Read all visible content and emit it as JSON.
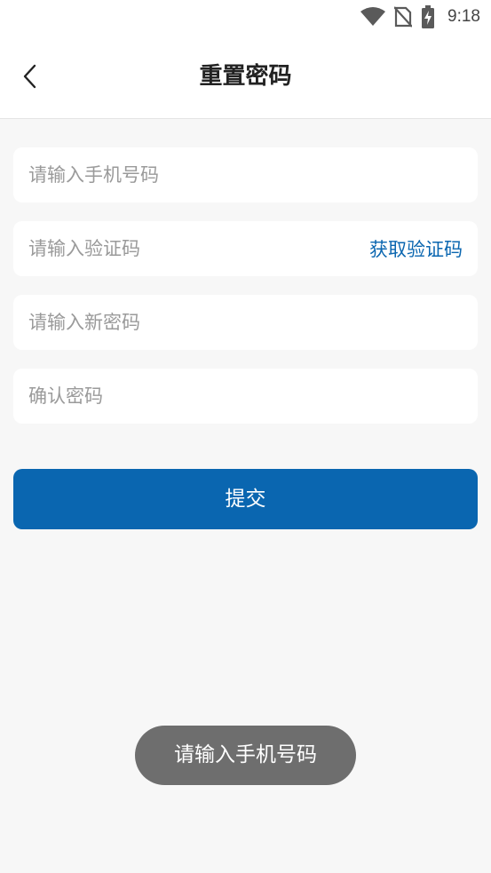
{
  "status_bar": {
    "time": "9:18",
    "icons": [
      "wifi-icon",
      "no-sim-icon",
      "battery-charging-icon"
    ]
  },
  "header": {
    "title": "重置密码",
    "back_icon": "chevron-left-icon"
  },
  "form": {
    "phone_placeholder": "请输入手机号码",
    "code_placeholder": "请输入验证码",
    "get_code_label": "获取验证码",
    "new_password_placeholder": "请输入新密码",
    "confirm_password_placeholder": "确认密码",
    "submit_label": "提交"
  },
  "toast": {
    "message": "请输入手机号码"
  },
  "colors": {
    "accent": "#0a66b0",
    "background": "#f7f7f7",
    "toast_bg": "#6e6e6e"
  }
}
